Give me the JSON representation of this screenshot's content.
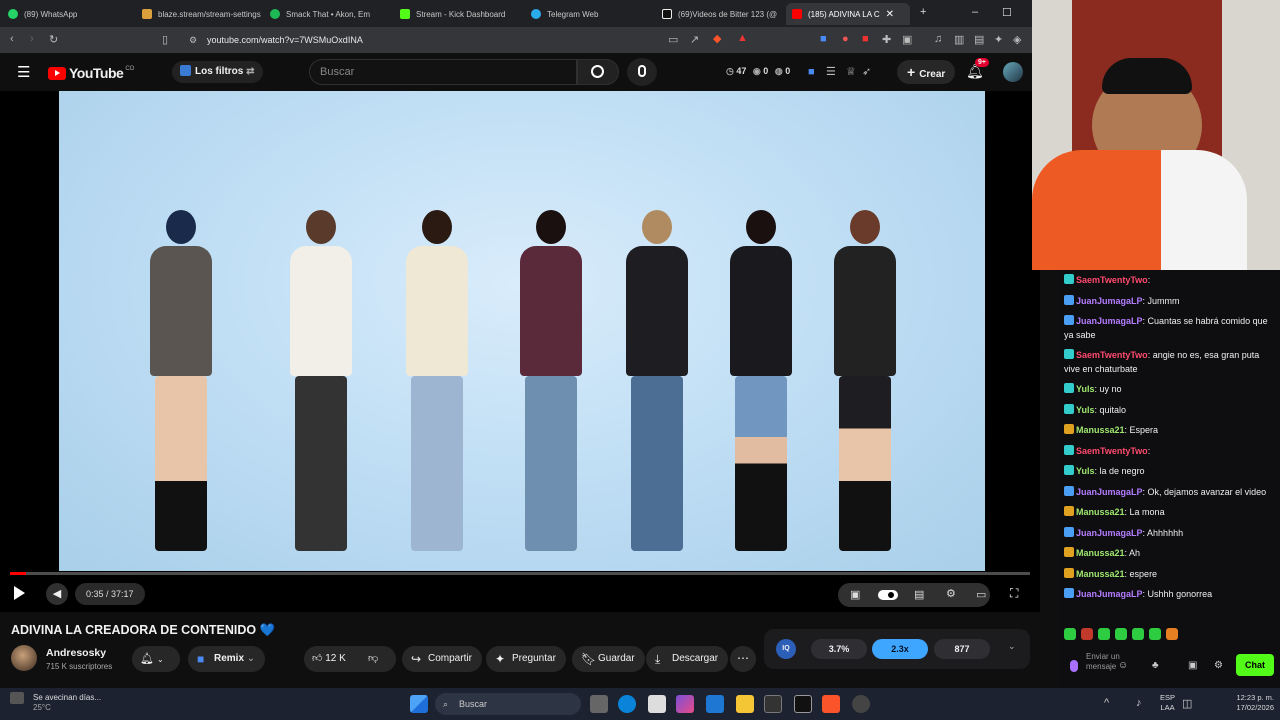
{
  "browser": {
    "tabs": [
      {
        "label": "(89) WhatsApp",
        "color": "#25d366"
      },
      {
        "label": "blaze.stream/stream-settings",
        "color": "#d9a03b"
      },
      {
        "label": "Smack That • Akon, Em",
        "color": "#1db954"
      },
      {
        "label": "Stream - Kick Dashboard",
        "color": "#53fc18"
      },
      {
        "label": "Telegram Web",
        "color": "#2aabee"
      },
      {
        "label": "(69)Videos de Bitter 123 (@",
        "color": "#eee"
      },
      {
        "label": "(185) ADIVINA LA C",
        "color": "#ff0000"
      }
    ],
    "url": "youtube.com/watch?v=7WSMuOxdINA"
  },
  "youtube": {
    "logo": "YouTube",
    "country": "CO",
    "filters": "Los filtros",
    "search_placeholder": "Buscar",
    "stats": {
      "a": "47",
      "b": "0",
      "c": "0"
    },
    "create": "Crear",
    "notif": "9+"
  },
  "player": {
    "time": "0:35 / 37:17",
    "progress": 0.016
  },
  "video": {
    "title": "ADIVINA LA CREADORA DE CONTENIDO 💙",
    "channel": "Andresosky",
    "subs": "715 K suscriptores",
    "remix": "Remix",
    "likes": "12 K",
    "share": "Compartir",
    "ask": "Preguntar",
    "save": "Guardar",
    "download": "Descargar"
  },
  "iq": {
    "v1": "3.7%",
    "v2": "2.3x",
    "v3": "877"
  },
  "chat": {
    "messages": [
      {
        "user": "SaemTwentyTwo",
        "color": "#ff4a6e",
        "text": "",
        "badge": "#3cc"
      },
      {
        "user": "JuanJumagaLP",
        "color": "#b47cff",
        "text": "Jummm",
        "badge": "#4a9ff5"
      },
      {
        "user": "JuanJumagaLP",
        "color": "#b47cff",
        "text": "Cuantas se habrá comido que ya sabe",
        "badge": "#4a9ff5"
      },
      {
        "user": "SaemTwentyTwo",
        "color": "#ff4a6e",
        "text": "angie no es, esa gran puta vive en chaturbate",
        "badge": "#3cc"
      },
      {
        "user": "Yuls",
        "color": "#9fe870",
        "text": "uy no",
        "badge": "#3cc"
      },
      {
        "user": "Yuls",
        "color": "#9fe870",
        "text": "quitalo",
        "badge": "#3cc"
      },
      {
        "user": "Manussa21",
        "color": "#9fe870",
        "text": "Espera",
        "badge": "#e0a020"
      },
      {
        "user": "SaemTwentyTwo",
        "color": "#ff4a6e",
        "text": "",
        "badge": "#3cc"
      },
      {
        "user": "Yuls",
        "color": "#9fe870",
        "text": "la de negro",
        "badge": "#3cc"
      },
      {
        "user": "JuanJumagaLP",
        "color": "#b47cff",
        "text": "Ok, dejamos avanzar el video",
        "badge": "#4a9ff5"
      },
      {
        "user": "Manussa21",
        "color": "#9fe870",
        "text": "La mona",
        "badge": "#e0a020"
      },
      {
        "user": "JuanJumagaLP",
        "color": "#b47cff",
        "text": "Ahhhhhh",
        "badge": "#4a9ff5"
      },
      {
        "user": "Manussa21",
        "color": "#9fe870",
        "text": "Ah",
        "badge": "#e0a020"
      },
      {
        "user": "Manussa21",
        "color": "#9fe870",
        "text": "espere",
        "badge": "#e0a020"
      },
      {
        "user": "JuanJumagaLP",
        "color": "#b47cff",
        "text": "Ushhh gonorrea",
        "badge": "#4a9ff5"
      }
    ],
    "input_placeholder": "Enviar un mensaje",
    "send": "Chat"
  },
  "taskbar": {
    "weather": "Se avecinan días...",
    "temp": "25°C",
    "search": "Buscar",
    "lang": "ESP",
    "region": "LAA",
    "time": "12:23 p. m.",
    "date": "17/02/2026"
  }
}
